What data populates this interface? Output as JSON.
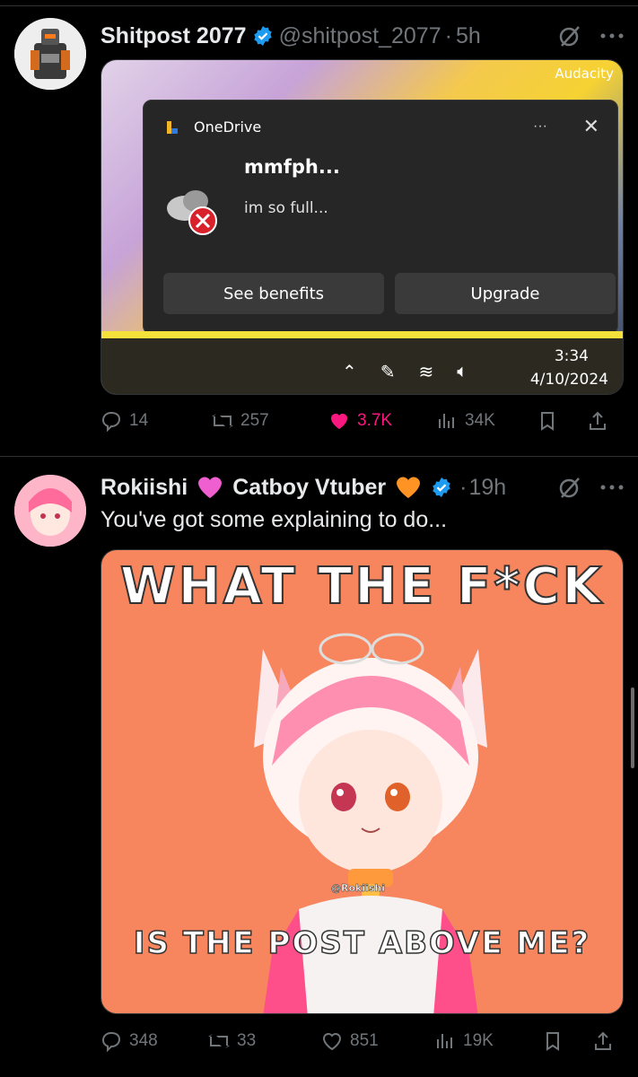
{
  "tweets": [
    {
      "display_name": "Shitpost 2077",
      "handle": "@shitpost_2077",
      "dot": "·",
      "time": "5h",
      "text": "",
      "media": {
        "app_label": "Audacity",
        "notification": {
          "app_name": "OneDrive",
          "title": "mmfph...",
          "message": "im so full...",
          "menu": "···",
          "close": "✕",
          "buttons": [
            "See benefits",
            "Upgrade"
          ]
        },
        "taskbar": {
          "time": "3:34",
          "date": "4/10/2024"
        }
      },
      "actions": {
        "replies": "14",
        "retweets": "257",
        "likes": "3.7K",
        "views": "34K"
      },
      "liked": true
    },
    {
      "display_name": "Rokiishi",
      "display_name_2": "Catboy Vtuber",
      "dot": "·",
      "time": "19h",
      "text": "You've got some explaining to do...",
      "media": {
        "top_caption": "WHAT THE F*CK",
        "bottom_caption": "IS THE POST ABOVE ME?",
        "watermark": "@Rokiishi"
      },
      "actions": {
        "replies": "348",
        "retweets": "33",
        "likes": "851",
        "views": "19K"
      },
      "liked": false
    }
  ],
  "colors": {
    "accent_like": "#f91880",
    "verified": "#1d9bf0",
    "muted": "#71767b"
  }
}
